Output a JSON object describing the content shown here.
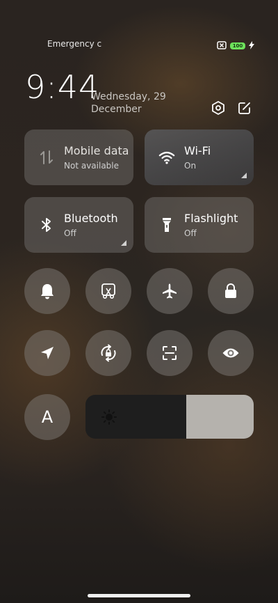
{
  "status_bar": {
    "carrier_text": "Emergency c",
    "battery_level": "100",
    "charging": true
  },
  "header": {
    "time": "9:44",
    "date_line1": "Wednesday, 29",
    "date_line2": "December"
  },
  "tiles": [
    {
      "label": "Mobile data",
      "state": "Not available",
      "icon": "mobile-data-icon"
    },
    {
      "label": "Wi-Fi",
      "state": "On",
      "icon": "wifi-icon"
    },
    {
      "label": "Bluetooth",
      "state": "Off",
      "icon": "bluetooth-icon"
    },
    {
      "label": "Flashlight",
      "state": "Off",
      "icon": "flashlight-icon"
    }
  ],
  "toggles_row1": [
    "bell-icon",
    "screenshot-icon",
    "airplane-icon",
    "lock-icon"
  ],
  "toggles_row2": [
    "location-icon",
    "rotation-lock-icon",
    "scan-icon",
    "eye-icon"
  ],
  "font_button": "A",
  "brightness": {
    "level": 0.6
  },
  "colors": {
    "battery": "#6ee25c",
    "active_tile": "#5a5a5c",
    "slider_fill": "#b5b2ad"
  }
}
